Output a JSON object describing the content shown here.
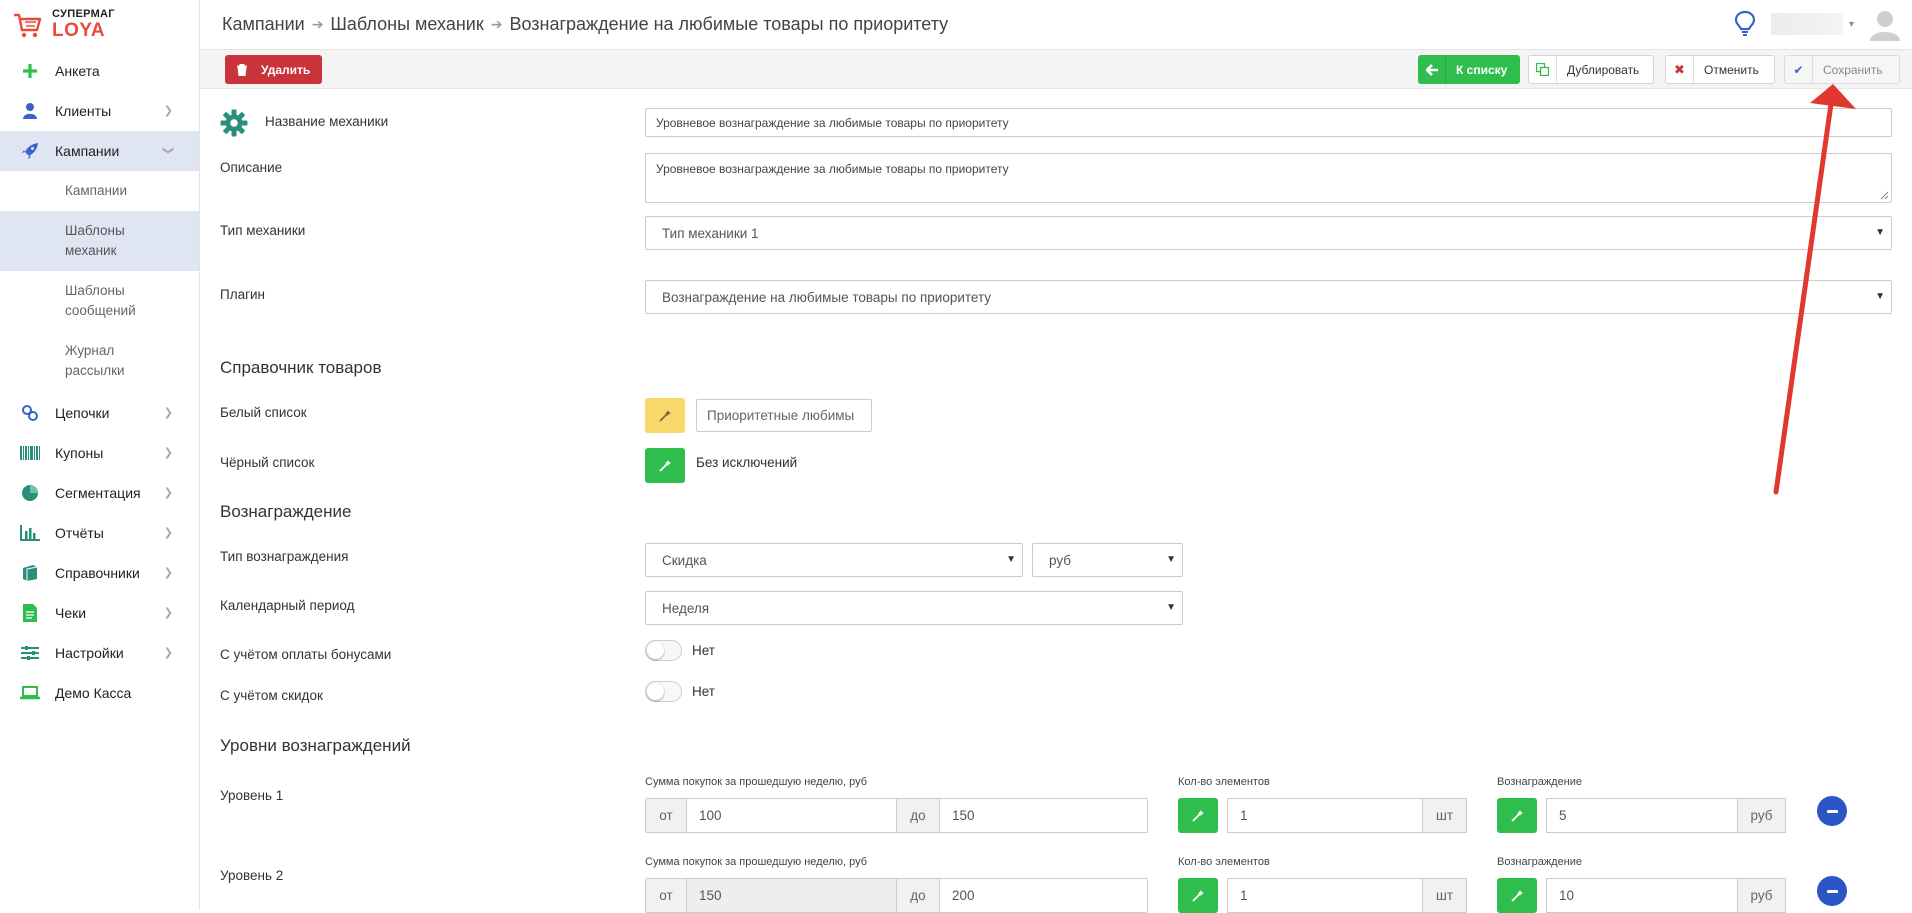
{
  "logo": {
    "top": "СУПЕРМАГ",
    "bottom": "LOYA"
  },
  "sidebar": {
    "items": [
      {
        "label": "Анкета",
        "icon": "plus-icon"
      },
      {
        "label": "Клиенты",
        "icon": "user-icon"
      },
      {
        "label": "Кампании",
        "icon": "rocket-icon"
      },
      {
        "label": "Цепочки",
        "icon": "link-icon"
      },
      {
        "label": "Купоны",
        "icon": "barcode-icon"
      },
      {
        "label": "Сегментация",
        "icon": "pie-icon"
      },
      {
        "label": "Отчёты",
        "icon": "bar-chart-icon"
      },
      {
        "label": "Справочники",
        "icon": "book-icon"
      },
      {
        "label": "Чеки",
        "icon": "receipt-icon"
      },
      {
        "label": "Настройки",
        "icon": "sliders-icon"
      },
      {
        "label": "Демо Касса",
        "icon": "laptop-icon"
      }
    ],
    "campaign_sub": [
      {
        "label": "Кампании"
      },
      {
        "label": "Шаблоны механик"
      },
      {
        "label": "Шаблоны сообщений"
      },
      {
        "label": "Журнал рассылки"
      }
    ]
  },
  "breadcrumb": [
    "Кампании",
    "Шаблоны механик",
    "Вознаграждение на любимые товары по приоритету"
  ],
  "toolbar": {
    "delete": "Удалить",
    "to_list": "К списку",
    "duplicate": "Дублировать",
    "cancel": "Отменить",
    "save": "Сохранить"
  },
  "form": {
    "name_label": "Название механики",
    "name_value": "Уровневое вознаграждение за любимые товары по приоритету",
    "desc_label": "Описание",
    "desc_value": "Уровневое вознаграждение за любимые товары по приоритету",
    "type_label": "Тип механики",
    "type_value": "Тип механики 1",
    "plugin_label": "Плагин",
    "plugin_value": "Вознаграждение на любимые товары по приоритету",
    "goods_section": "Справочник товаров",
    "white_label": "Белый список",
    "white_value": "Приоритетные любимы",
    "black_label": "Чёрный список",
    "black_value": "Без исключений",
    "reward_section": "Вознаграждение",
    "reward_type_label": "Тип вознаграждения",
    "reward_type_value": "Скидка",
    "currency_value": "руб",
    "period_label": "Календарный период",
    "period_value": "Неделя",
    "bonus_label": "С учётом оплаты бонусами",
    "bonus_value": "Нет",
    "discount_label": "С учётом скидок",
    "discount_value": "Нет",
    "levels_section": "Уровни вознаграждений"
  },
  "levels": [
    {
      "name": "Уровень 1",
      "sum_label": "Сумма покупок за прошедшую неделю, руб",
      "from_prefix": "от",
      "from": "100",
      "to_prefix": "до",
      "to": "150",
      "count_label": "Кол-во элементов",
      "count": "1",
      "count_unit": "шт",
      "reward_label": "Вознаграждение",
      "reward": "5",
      "reward_unit": "руб"
    },
    {
      "name": "Уровень 2",
      "sum_label": "Сумма покупок за прошедшую неделю, руб",
      "from_prefix": "от",
      "from": "150",
      "to_prefix": "до",
      "to": "200",
      "count_label": "Кол-во элементов",
      "count": "1",
      "count_unit": "шт",
      "reward_label": "Вознаграждение",
      "reward": "10",
      "reward_unit": "руб"
    }
  ],
  "colors": {
    "accent_green": "#2fbe4e",
    "danger": "#c9343b",
    "brand_red": "#e84b3c",
    "arrow": "#e0382e",
    "minus_blue": "#2a56c6"
  }
}
